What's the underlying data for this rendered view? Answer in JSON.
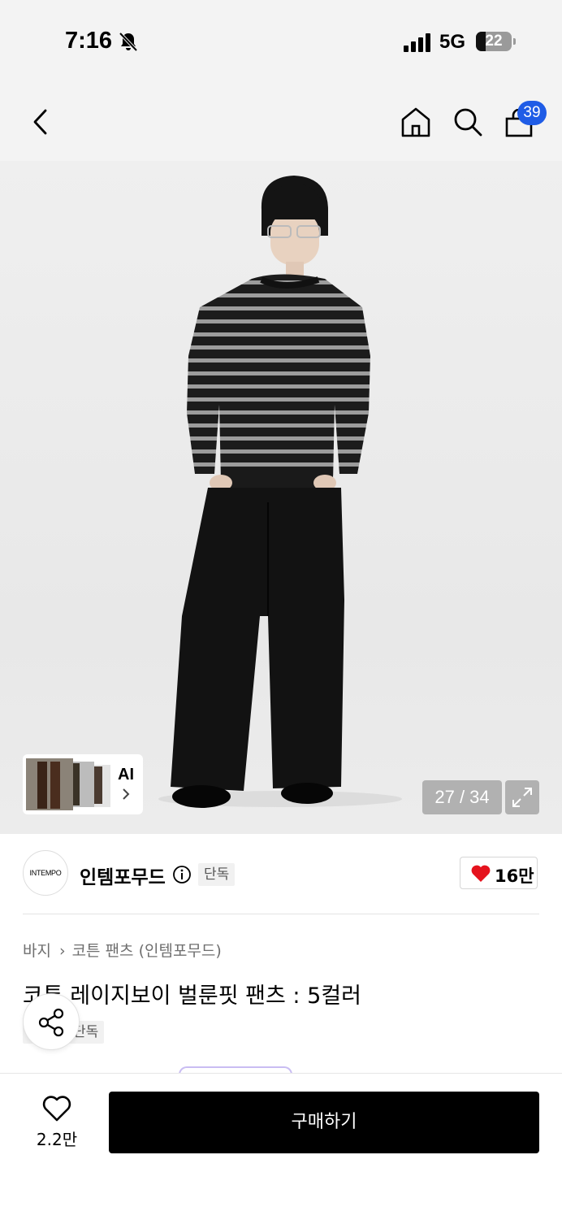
{
  "status_bar": {
    "time": "7:16",
    "network": "5G",
    "battery": "22"
  },
  "header": {
    "cart_count": "39"
  },
  "gallery": {
    "ai_label": "AI",
    "counter": "27 / 34"
  },
  "brand": {
    "logo_text": "INTEMPO",
    "name": "인템포무드",
    "badge": "단독",
    "like_count": "16만"
  },
  "product": {
    "breadcrumb": [
      "바지",
      "코튼 팬츠 (인템포무드)"
    ],
    "title": "코튼 레이지보이 벌룬핏 팬츠 : 5컬러",
    "tag": "단독"
  },
  "bottom_bar": {
    "wish_count": "2.2만",
    "buy_label": "구매하기"
  },
  "colors": {
    "accent_blue": "#1f5ce6",
    "heart_red": "#e5131d",
    "primary_black": "#000000"
  }
}
